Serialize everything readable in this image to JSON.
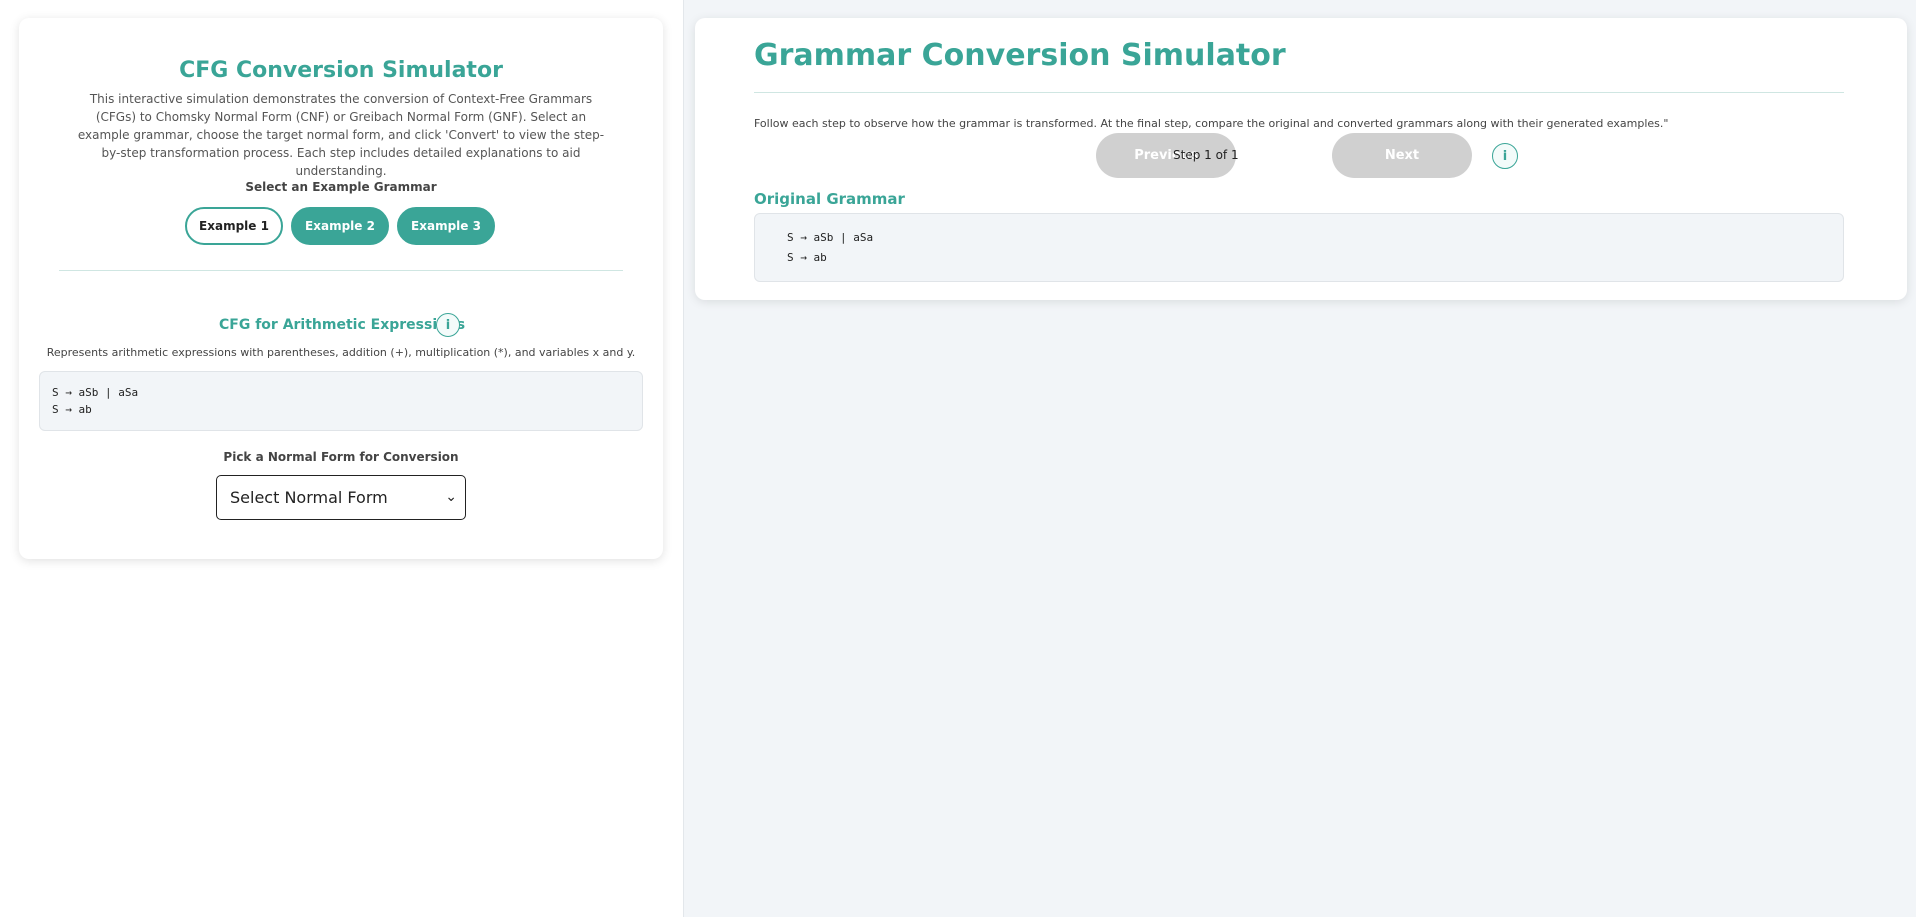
{
  "left": {
    "title": "CFG Conversion Simulator",
    "description": "This interactive simulation demonstrates the conversion of Context-Free Grammars (CFGs) to Chomsky Normal Form (CNF) or Greibach Normal Form (GNF). Select an example grammar, choose the target normal form, and click 'Convert' to view the step-by-step transformation process. Each step includes detailed explanations to aid understanding.",
    "select_example_label": "Select an Example Grammar",
    "examples": [
      "Example 1",
      "Example 2",
      "Example 3"
    ],
    "active_example": "Example 1",
    "grammar_title": "CFG for Arithmetic Expressions",
    "grammar_description": "Represents arithmetic expressions with parentheses, addition (+), multiplication (*), and variables x and y.",
    "grammar_rules": [
      "S → aSb | aSa",
      "S → ab"
    ],
    "normal_form_label": "Pick a Normal Form for Conversion",
    "normal_form_selected": "Select Normal Form"
  },
  "right": {
    "title": "Grammar Conversion Simulator",
    "instructions": "Follow each step to observe how the grammar is transformed. At the final step, compare the original and converted grammars along with their generated examples.\"",
    "previous_label": "Previous",
    "step_text": "Step 1 of 1",
    "next_label": "Next",
    "original_grammar_title": "Original Grammar",
    "original_rules": [
      "S → aSb | aSa",
      "S → ab"
    ]
  },
  "icons": {
    "info": "i",
    "chevron": "⌄"
  },
  "colors": {
    "accent": "#3aa597",
    "disabled": "#d0d0d0",
    "background": "#f2f5f8"
  }
}
